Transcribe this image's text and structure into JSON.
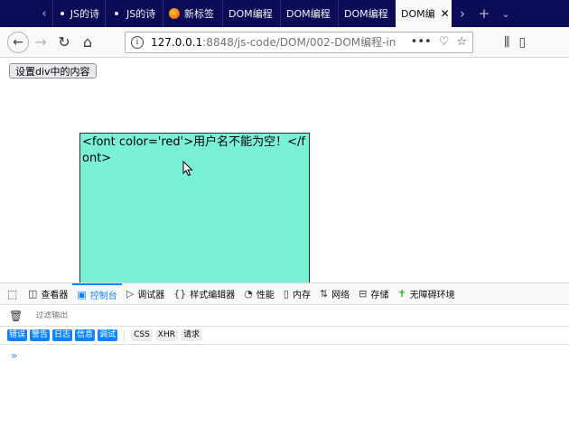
{
  "tabs": [
    {
      "label": "JS的诗",
      "icon": "dot"
    },
    {
      "label": "JS的诗",
      "icon": "dot"
    },
    {
      "label": "新标签",
      "icon": "firefox-icon"
    },
    {
      "label": "DOM编程",
      "icon": "globe-icon"
    },
    {
      "label": "DOM编程",
      "icon": "globe-icon"
    },
    {
      "label": "DOM编程",
      "icon": "globe-icon"
    },
    {
      "label": "DOM编",
      "icon": "globe-icon",
      "active": true
    }
  ],
  "url": {
    "host": "127.0.0.1",
    "rest": ":8848/js-code/DOM/002-DOM编程-in"
  },
  "page": {
    "button_label": "设置div中的内容",
    "div_text": "<font color='red'>用户名不能为空！</font>"
  },
  "devtools": {
    "tabs": [
      "查看器",
      "控制台",
      "调试器",
      "样式编辑器",
      "性能",
      "内存",
      "网络",
      "存储",
      "无障碍环境"
    ],
    "active_tab": "控制台",
    "filter_placeholder": "过滤输出",
    "levels": [
      "错误",
      "警告",
      "日志",
      "信息",
      "调试"
    ],
    "categories": [
      "CSS",
      "XHR",
      "请求"
    ],
    "prompt": "»"
  },
  "colors": {
    "tabstrip": "#0c0c56",
    "div_background": "#7af0d9",
    "accent": "#0a84ff"
  }
}
